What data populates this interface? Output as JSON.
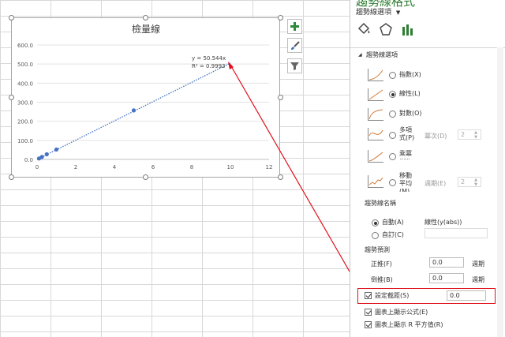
{
  "sheet": {
    "chart": {
      "title": "檢量線",
      "trendline_equation": "y = 50.544x",
      "trendline_r2": "R² = 0.9993"
    },
    "side_buttons": [
      {
        "icon": "plus-icon"
      },
      {
        "icon": "brush-icon"
      },
      {
        "icon": "filter-icon"
      }
    ]
  },
  "chart_data": {
    "type": "scatter",
    "title": "檢量線",
    "xlabel": "",
    "ylabel": "",
    "xlim": [
      0,
      12
    ],
    "ylim": [
      0,
      600
    ],
    "x_ticks": [
      "0",
      "2",
      "4",
      "6",
      "8",
      "10",
      "12"
    ],
    "y_ticks": [
      "0.0",
      "100.0",
      "200.0",
      "300.0",
      "400.0",
      "500.0",
      "600.0"
    ],
    "grid": true,
    "series": [
      {
        "x": [
          0.1,
          0.25,
          0.5,
          1,
          5
        ],
        "y": [
          5,
          13,
          27,
          52,
          257
        ]
      }
    ],
    "trendline": {
      "slope": 50.544,
      "r2": 0.9993,
      "x_range": [
        0,
        10
      ],
      "style": "dotted"
    }
  },
  "pane": {
    "title": "趨勢線格式",
    "dropdown_label": "趨勢線選項",
    "section_label": "趨勢線選項",
    "options": [
      {
        "label": "指數(X)",
        "selected": false
      },
      {
        "label": "線性(L)",
        "selected": true
      },
      {
        "label": "對數(O)",
        "selected": false
      },
      {
        "label": "多項式(P)",
        "selected": false
      },
      {
        "label": "乘冪(W)",
        "selected": false
      },
      {
        "label": "移動平均(M)",
        "selected": false
      }
    ],
    "order_label": "冪次(D)",
    "order_value": "2",
    "period_label": "週期(E)",
    "period_value": "2",
    "name_header": "趨勢線名稱",
    "name_auto": "自動(A)",
    "name_auto_value": "線性(y(abs))",
    "name_custom": "自訂(C)",
    "forecast_header": "趨勢預測",
    "forward_label": "正推(F)",
    "forward_value": "0.0",
    "backward_label": "倒推(B)",
    "backward_value": "0.0",
    "period_unit": "週期",
    "intercept_label": "設定截距(S)",
    "intercept_value": "0.0",
    "show_equation_label": "圖表上顯示公式(E)",
    "show_r2_label": "圖表上顯示 R 平方值(R)",
    "colors": {
      "accent": "#2e7d32",
      "highlight": "#e0101a",
      "series": "#4472c4"
    }
  }
}
